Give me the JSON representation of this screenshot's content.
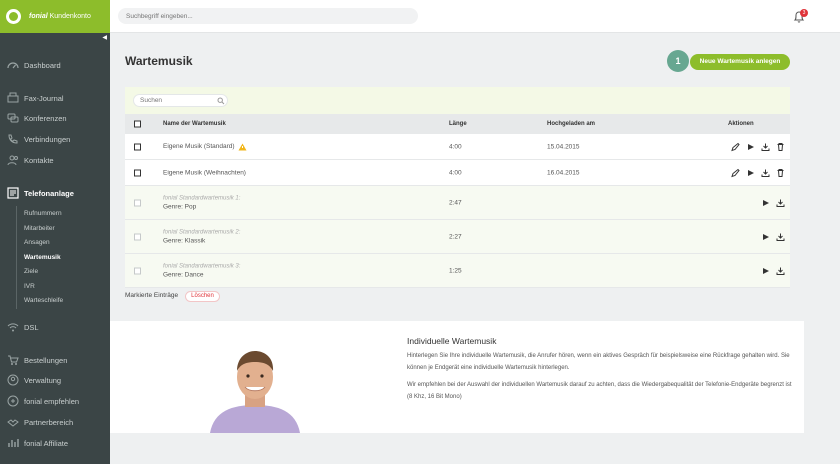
{
  "brand": {
    "name": "fonial",
    "suffix": "Kundenkonto",
    "accent": "#8dbd2b"
  },
  "sidebar": {
    "items": [
      {
        "label": "Dashboard",
        "icon": "gauge-icon"
      },
      {
        "label": "Fax-Journal",
        "icon": "fax-icon"
      },
      {
        "label": "Konferenzen",
        "icon": "conference-icon"
      },
      {
        "label": "Verbindungen",
        "icon": "phone-icon"
      },
      {
        "label": "Kontakte",
        "icon": "contacts-icon"
      },
      {
        "label": "Telefonanlage",
        "icon": "pbx-icon"
      },
      {
        "label": "DSL",
        "icon": "wifi-icon"
      },
      {
        "label": "Bestellungen",
        "icon": "cart-icon"
      },
      {
        "label": "Verwaltung",
        "icon": "user-icon"
      },
      {
        "label": "fonial empfehlen",
        "icon": "recommend-icon"
      },
      {
        "label": "Partnerbereich",
        "icon": "handshake-icon"
      },
      {
        "label": "fonial Affiliate",
        "icon": "affiliate-icon"
      }
    ],
    "subitems": [
      {
        "label": "Rufnummern"
      },
      {
        "label": "Mitarbeiter"
      },
      {
        "label": "Ansagen"
      },
      {
        "label": "Wartemusik"
      },
      {
        "label": "Ziele"
      },
      {
        "label": "IVR"
      },
      {
        "label": "Warteschleife"
      }
    ]
  },
  "topbar": {
    "search_placeholder": "Suchbegriff eingeben...",
    "notification_count": "3"
  },
  "page": {
    "title": "Wartemusik",
    "step": "1",
    "new_button": "Neue Wartemusik anlegen"
  },
  "filter": {
    "placeholder": "Suchen"
  },
  "table": {
    "headers": {
      "name": "Name der Wartemusik",
      "length": "Länge",
      "uploaded": "Hochgeladen am",
      "actions": "Aktionen"
    },
    "rows": [
      {
        "name": "Eigene Musik (Standard)",
        "length": "4:00",
        "uploaded": "15.04.2015"
      },
      {
        "name": "Eigene Musik (Weihnachten)",
        "length": "4:00",
        "uploaded": "16.04.2015"
      }
    ],
    "standard_rows": [
      {
        "name": "fonial Standardwartemusik 1:",
        "genre": "Genre: Pop",
        "length": "2:47"
      },
      {
        "name": "fonial Standardwartemusik 2:",
        "genre": "Genre: Klassik",
        "length": "2:27"
      },
      {
        "name": "fonial Standardwartemusik 3:",
        "genre": "Genre: Dance",
        "length": "1:25"
      }
    ]
  },
  "bulk": {
    "label": "Markierte Einträge",
    "delete": "Löschen"
  },
  "info": {
    "title": "Individuelle Wartemusik",
    "p1": "Hinterlegen Sie Ihre individuelle Wartemusik, die Anrufer hören, wenn ein aktives Gespräch für beispielsweise eine Rückfrage gehalten wird. Sie können je Endgerät eine individuelle Wartemusik hinterlegen.",
    "p2": "Wir empfehlen bei der Auswahl der individuellen Wartemusik darauf zu achten, dass die Wiedergabequalität der Telefonie-Endgeräte begrenzt ist (8 Khz, 16 Bit Mono)"
  }
}
